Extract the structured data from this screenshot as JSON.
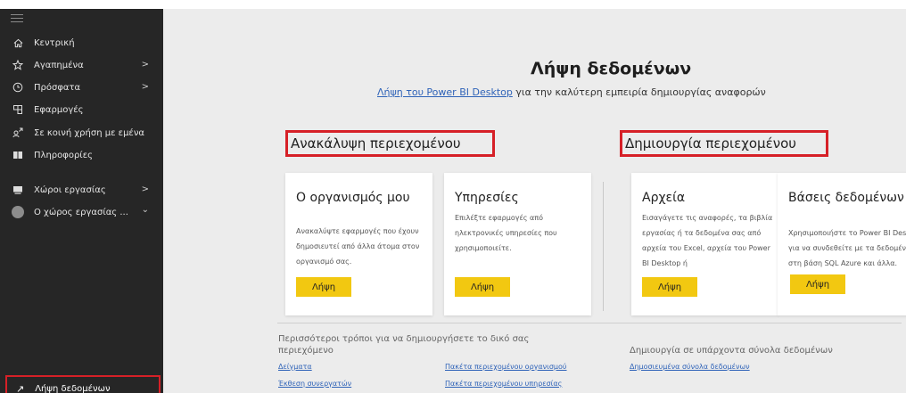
{
  "sidebar": {
    "items": [
      {
        "label": "Κεντρική",
        "icon": "home-icon"
      },
      {
        "label": "Αγαπημένα",
        "icon": "star-icon",
        "chevron": ">"
      },
      {
        "label": "Πρόσφατα",
        "icon": "clock-icon",
        "chevron": ">"
      },
      {
        "label": "Εφαρμογές",
        "icon": "apps-icon"
      },
      {
        "label": "Σε κοινή χρήση με εμένα",
        "icon": "shared-icon"
      },
      {
        "label": "Πληροφορίες",
        "icon": "book-icon"
      },
      {
        "label": "Χώροι εργασίας",
        "icon": "workspaces-icon",
        "chevron": ">"
      },
      {
        "label": "Ο χώρος εργασίας ...",
        "icon": "avatar-icon",
        "chevron": "⌄"
      }
    ],
    "get_data": {
      "label": "Λήψη δεδομένων",
      "icon": "arrow-up-right-icon"
    }
  },
  "main": {
    "title": "Λήψη δεδομένων",
    "sub_link": "Λήψη του Power BI Desktop",
    "sub_text": " για την καλύτερη εμπειρία δημιουργίας αναφορών",
    "discover_title": "Ανακάλυψη περιεχομένου",
    "create_title": "Δημιουργία περιεχομένου",
    "cards": [
      {
        "title": "Ο οργανισμός μου",
        "desc": "Ανακαλύψτε εφαρμογές που έχουν δημοσιευτεί από άλλα άτομα στον οργανισμό σας.",
        "button": "Λήψη"
      },
      {
        "title": "Υπηρεσίες",
        "desc": "Επιλέξτε εφαρμογές από ηλεκτρονικές υπηρεσίες που χρησιμοποιείτε.",
        "button": "Λήψη"
      },
      {
        "title": "Αρχεία",
        "desc": "Εισαγάγετε τις αναφορές, τα βιβλία εργασίας ή τα δεδομένα σας από αρχεία του Excel, αρχεία του Power BI Desktop ή",
        "button": "Λήψη"
      },
      {
        "title": "Βάσεις δεδομένων",
        "desc": "Χρησιμοποιήστε το Power BI Desktop για να συνδεθείτε με τα δεδομένα στη βάση SQL Azure και άλλα.",
        "button": "Λήψη"
      }
    ],
    "more_ways_title": "Περισσότεροι τρόποι για να δημιουργήσετε το δικό σας περιεχόμενο",
    "existing_title": "Δημιουργία σε υπάρχοντα σύνολα δεδομένων",
    "links": {
      "samples": "Δείγματα",
      "partner_showcase": "Έκθεση συνεργατών",
      "org_content_packs": "Πακέτα περιεχομένου οργανισμού",
      "service_content_packs": "Πακέτα περιεχομένου υπηρεσίας",
      "published_datasets": "Δημοσιευμένα σύνολα δεδομένων"
    }
  },
  "colors": {
    "accent_yellow": "#f2c811",
    "highlight_red": "#d62027",
    "link_blue": "#2f63b8",
    "sidebar_bg": "#262626"
  }
}
